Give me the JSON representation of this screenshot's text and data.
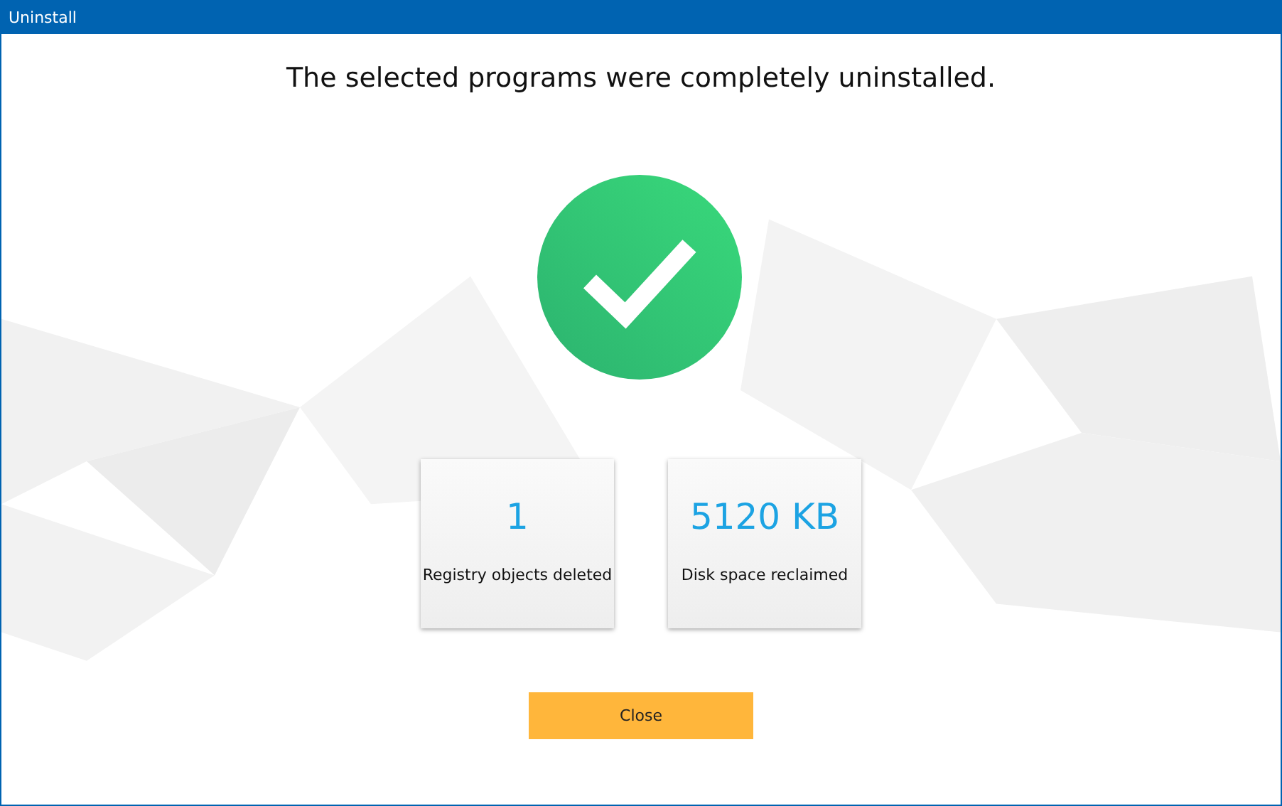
{
  "window": {
    "title": "Uninstall"
  },
  "heading": "The selected programs were completely uninstalled.",
  "stats": [
    {
      "value": "1",
      "label": "Registry objects deleted"
    },
    {
      "value": "5120 KB",
      "label": "Disk space reclaimed"
    }
  ],
  "buttons": [
    {
      "label": "Close"
    }
  ]
}
